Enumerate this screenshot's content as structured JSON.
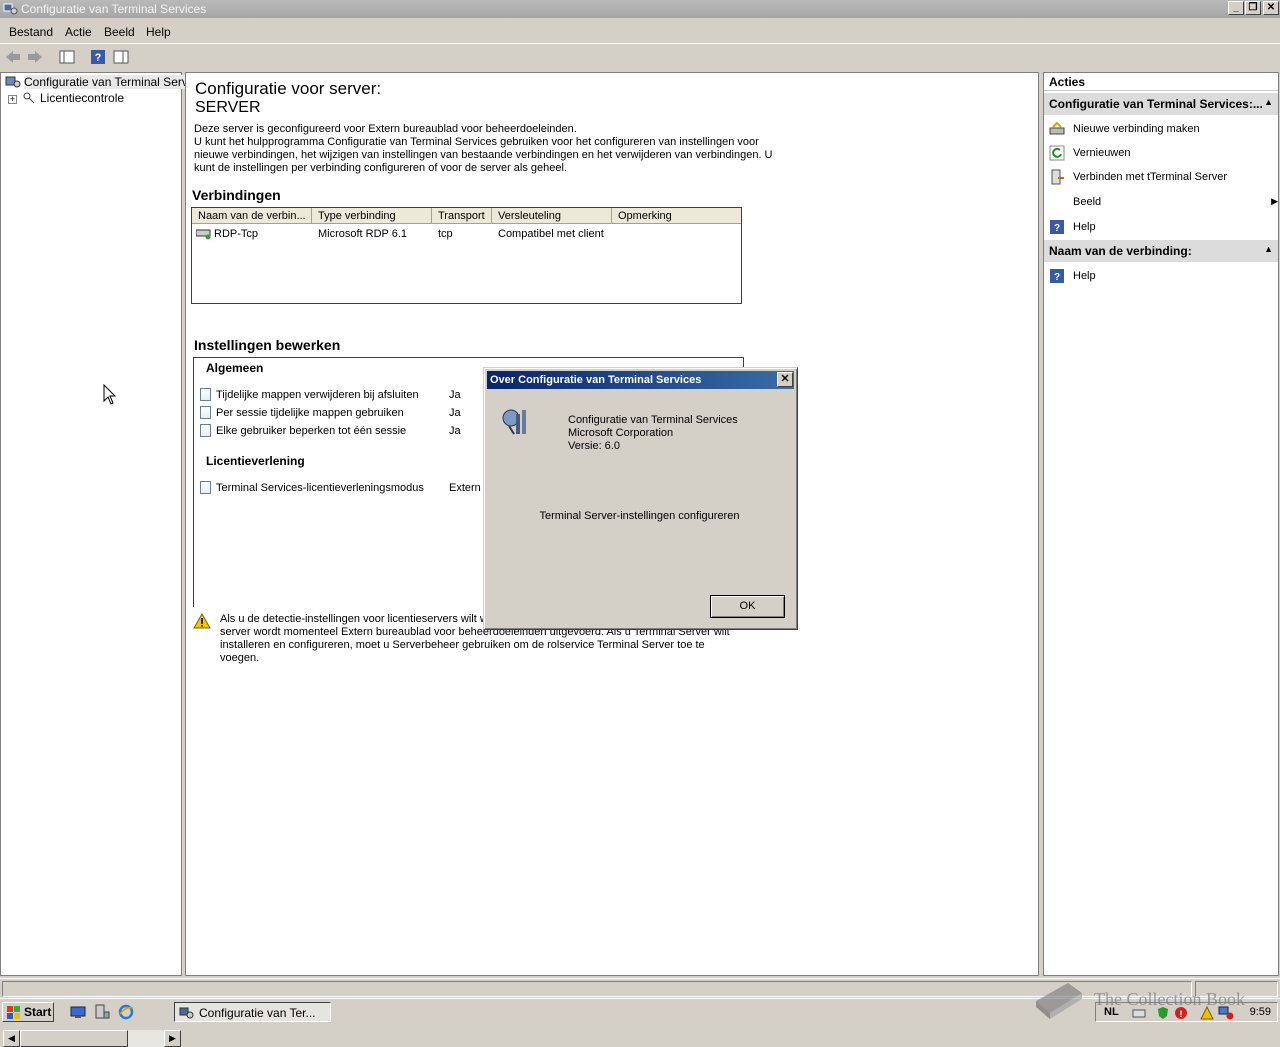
{
  "window": {
    "title": "Configuratie van Terminal Services"
  },
  "menu": [
    "Bestand",
    "Actie",
    "Beeld",
    "Help"
  ],
  "tree": {
    "root": "Configuratie van Terminal Servic",
    "child": "Licentiecontrole"
  },
  "main": {
    "heading": "Configuratie voor server:",
    "server": "SERVER",
    "desc1": "Deze server is geconfigureerd voor Extern bureaublad voor beheerdoeleinden.",
    "desc2": "U kunt het hulpprogramma Configuratie van Terminal Services gebruiken voor het configureren van instellingen voor nieuwe verbindingen, het wijzigen van instellingen van bestaande verbindingen en het verwijderen van verbindingen. U kunt de instellingen per verbinding configureren of voor de server als geheel.",
    "connections_title": "Verbindingen",
    "columns": [
      "Naam van de verbin...",
      "Type verbinding",
      "Transport",
      "Versleuteling",
      "Opmerking"
    ],
    "row": [
      "RDP-Tcp",
      "Microsoft RDP 6.1",
      "tcp",
      "Compatibel met client",
      ""
    ],
    "settings_title": "Instellingen bewerken",
    "general": "Algemeen",
    "general_items": [
      {
        "label": "Tijdelijke mappen verwijderen bij afsluiten",
        "value": "Ja"
      },
      {
        "label": "Per sessie tijdelijke mappen gebruiken",
        "value": "Ja"
      },
      {
        "label": "Elke gebruiker beperken tot één sessie",
        "value": "Ja"
      }
    ],
    "licensing": "Licentieverlening",
    "licensing_items": [
      {
        "label": "Terminal Services-licentieverleningsmodus",
        "value": "Extern I"
      }
    ],
    "warning": "Als u de detectie-instellingen voor licentieservers wilt wijz eerst configureren als terminalserver. Op deze server wordt momenteel Extern bureaublad voor beheerdoeleinden uitgevoerd. Als u Terminal Server wilt installeren en configureren, moet u Serverbeheer gebruiken om de rolservice Terminal Server toe te voegen."
  },
  "actions": {
    "title": "Acties",
    "section1": "Configuratie van Terminal Services:...",
    "items1": [
      "Nieuwe verbinding maken",
      "Vernieuwen",
      "Verbinden met tTerminal Server",
      "Beeld",
      "Help"
    ],
    "section2": "Naam van de verbinding:",
    "items2": [
      "Help"
    ]
  },
  "dialog": {
    "title": "Over Configuratie van Terminal Services",
    "product": "Configuratie van Terminal Services",
    "company": "Microsoft Corporation",
    "version": "Versie: 6.0",
    "description": "Terminal Server-instellingen configureren",
    "ok": "OK"
  },
  "taskbar": {
    "start": "Start",
    "task": "Configuratie van Ter...",
    "lang": "NL",
    "clock": "9:59"
  },
  "watermark": "The Collection Book"
}
